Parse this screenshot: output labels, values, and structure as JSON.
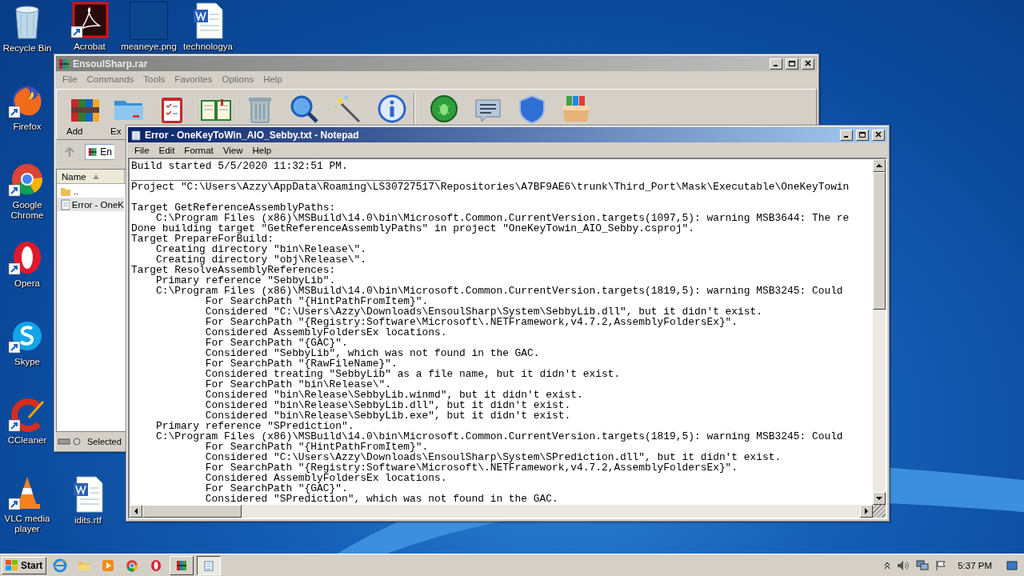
{
  "desktop_left_column": [
    {
      "label": "Recycle Bin",
      "kind": "trash",
      "shortcut": false
    },
    {
      "label": "Firefox",
      "kind": "firefox",
      "shortcut": true
    },
    {
      "label": "Google Chrome",
      "kind": "chrome",
      "shortcut": true
    },
    {
      "label": "Opera",
      "kind": "opera",
      "shortcut": true
    },
    {
      "label": "Skype",
      "kind": "skype",
      "shortcut": true
    },
    {
      "label": "CCleaner",
      "kind": "ccleaner",
      "shortcut": true
    },
    {
      "label": "VLC media player",
      "kind": "vlc",
      "shortcut": true
    }
  ],
  "desktop_top_row": [
    {
      "label": "Acrobat",
      "kind": "acrobat",
      "shortcut": true
    },
    {
      "label": "meaneye.png",
      "kind": "image",
      "shortcut": false
    },
    {
      "label": "technologya",
      "kind": "word",
      "shortcut": false
    }
  ],
  "desktop_bottom_row": [
    {
      "label": "idits.rtf",
      "kind": "word",
      "shortcut": false
    }
  ],
  "winrar": {
    "title": "EnsoulSharp.rar",
    "active": false,
    "menu": [
      "File",
      "Commands",
      "Tools",
      "Favorites",
      "Options",
      "Help"
    ],
    "toolbar": [
      {
        "label": "Add",
        "kind": "add"
      },
      {
        "label": "Ex",
        "kind": "extract"
      },
      {
        "kind": "test"
      },
      {
        "kind": "view"
      },
      {
        "kind": "delete"
      },
      {
        "kind": "find"
      },
      {
        "kind": "wizard"
      },
      {
        "kind": "info"
      },
      {
        "kind": "separator"
      },
      {
        "kind": "virus"
      },
      {
        "kind": "comment"
      },
      {
        "kind": "protect"
      },
      {
        "kind": "sfx"
      }
    ],
    "address": "En",
    "column": "Name",
    "files": [
      {
        "name": "..",
        "kind": "folder",
        "selected": false
      },
      {
        "name": "Error - OneK",
        "kind": "text",
        "selected": true
      }
    ],
    "status": "Selected"
  },
  "notepad": {
    "title": "Error - OneKeyToWin_AIO_Sebby.txt - Notepad",
    "active": true,
    "menu": [
      "File",
      "Edit",
      "Format",
      "View",
      "Help"
    ],
    "lines": [
      {
        "text": "Build started 5/5/2020 11:32:51 PM."
      },
      {
        "text": "__________________________________________________"
      },
      {
        "text": "Project \"C:\\Users\\Azzy\\AppData\\Roaming\\LS30727517\\Repositories\\A7BF9AE6\\trunk\\Third_Port\\Mask\\Executable\\OneKeyTowin",
        "blank_after": true
      },
      {
        "text": "Target GetReferenceAssemblyPaths:"
      },
      {
        "text": "    C:\\Program Files (x86)\\MSBuild\\14.0\\bin\\Microsoft.Common.CurrentVersion.targets(1097,5): warning MSB3644: The re"
      },
      {
        "text": "Done building target \"GetReferenceAssemblyPaths\" in project \"OneKeyTowin_AIO_Sebby.csproj\"."
      },
      {
        "text": "Target PrepareForBuild:"
      },
      {
        "text": "    Creating directory \"bin\\Release\\\"."
      },
      {
        "text": "    Creating directory \"obj\\Release\\\"."
      },
      {
        "text": "Target ResolveAssemblyReferences:"
      },
      {
        "text": "    Primary reference \"SebbyLib\"."
      },
      {
        "text": "    C:\\Program Files (x86)\\MSBuild\\14.0\\bin\\Microsoft.Common.CurrentVersion.targets(1819,5): warning MSB3245: Could"
      },
      {
        "text": "            For SearchPath \"{HintPathFromItem}\"."
      },
      {
        "text": "            Considered \"C:\\Users\\Azzy\\Downloads\\EnsoulSharp\\System\\SebbyLib.dll\", but it didn't exist."
      },
      {
        "text": "            For SearchPath \"{Registry:Software\\Microsoft\\.NETFramework,v4.7.2,AssemblyFoldersEx}\"."
      },
      {
        "text": "            Considered AssemblyFoldersEx locations."
      },
      {
        "text": "            For SearchPath \"{GAC}\"."
      },
      {
        "text": "            Considered \"SebbyLib\", which was not found in the GAC."
      },
      {
        "text": "            For SearchPath \"{RawFileName}\"."
      },
      {
        "text": "            Considered treating \"SebbyLib\" as a file name, but it didn't exist."
      },
      {
        "text": "            For SearchPath \"bin\\Release\\\"."
      },
      {
        "text": "            Considered \"bin\\Release\\SebbyLib.winmd\", but it didn't exist."
      },
      {
        "text": "            Considered \"bin\\Release\\SebbyLib.dll\", but it didn't exist."
      },
      {
        "text": "            Considered \"bin\\Release\\SebbyLib.exe\", but it didn't exist."
      },
      {
        "text": "    Primary reference \"SPrediction\"."
      },
      {
        "text": "    C:\\Program Files (x86)\\MSBuild\\14.0\\bin\\Microsoft.Common.CurrentVersion.targets(1819,5): warning MSB3245: Could"
      },
      {
        "text": "            For SearchPath \"{HintPathFromItem}\"."
      },
      {
        "text": "            Considered \"C:\\Users\\Azzy\\Downloads\\EnsoulSharp\\System\\SPrediction.dll\", but it didn't exist."
      },
      {
        "text": "            For SearchPath \"{Registry:Software\\Microsoft\\.NETFramework,v4.7.2,AssemblyFoldersEx}\"."
      },
      {
        "text": "            Considered AssemblyFoldersEx locations."
      },
      {
        "text": "            For SearchPath \"{GAC}\"."
      },
      {
        "text": "            Considered \"SPrediction\", which was not found in the GAC."
      }
    ]
  },
  "taskbar": {
    "start": "Start",
    "quick_launch": [
      {
        "kind": "ie"
      },
      {
        "kind": "explorer"
      },
      {
        "kind": "media"
      },
      {
        "kind": "chrome"
      },
      {
        "kind": "opera"
      }
    ],
    "windows": [
      {
        "kind": "winrar",
        "selected": false
      },
      {
        "kind": "notepad",
        "selected": true
      }
    ],
    "clock": "5:37 PM"
  }
}
